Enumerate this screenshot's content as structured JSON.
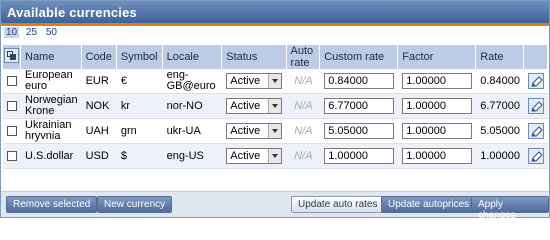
{
  "title": "Available currencies",
  "pager": {
    "sizes": [
      "10",
      "25",
      "50"
    ]
  },
  "columns": {
    "name": "Name",
    "code": "Code",
    "symbol": "Symbol",
    "locale": "Locale",
    "status": "Status",
    "auto_rate": "Auto rate",
    "custom_rate": "Custom rate",
    "factor": "Factor",
    "rate": "Rate"
  },
  "rows": [
    {
      "name": "European euro",
      "code": "EUR",
      "symbol": "€",
      "locale": "eng-GB@euro",
      "status": "Active",
      "auto_rate": "N/A",
      "custom_rate": "0.84000",
      "factor": "1.00000",
      "rate": "0.84000"
    },
    {
      "name": "Norwegian Krone",
      "code": "NOK",
      "symbol": "kr",
      "locale": "nor-NO",
      "status": "Active",
      "auto_rate": "N/A",
      "custom_rate": "6.77000",
      "factor": "1.00000",
      "rate": "6.77000"
    },
    {
      "name": "Ukrainian hryvnia",
      "code": "UAH",
      "symbol": "grn",
      "locale": "ukr-UA",
      "status": "Active",
      "auto_rate": "N/A",
      "custom_rate": "5.05000",
      "factor": "1.00000",
      "rate": "5.05000"
    },
    {
      "name": "U.S.dollar",
      "code": "USD",
      "symbol": "$",
      "locale": "eng-US",
      "status": "Active",
      "auto_rate": "N/A",
      "custom_rate": "1.00000",
      "factor": "1.00000",
      "rate": "1.00000"
    }
  ],
  "buttons": {
    "remove_selected": "Remove selected",
    "new_currency": "New currency",
    "update_auto_rates": "Update auto rates",
    "update_autoprices": "Update autoprices",
    "apply_changes": "Apply changes"
  },
  "colors": {
    "title_bar": "#4a6fa5",
    "title_underline": "#e07b1a",
    "header_bg": "#bccce4",
    "row_alt": "#eef2f8"
  },
  "icons": {
    "select_all": "select-all-icon",
    "edit": "edit-icon",
    "dropdown": "chevron-down-icon"
  }
}
